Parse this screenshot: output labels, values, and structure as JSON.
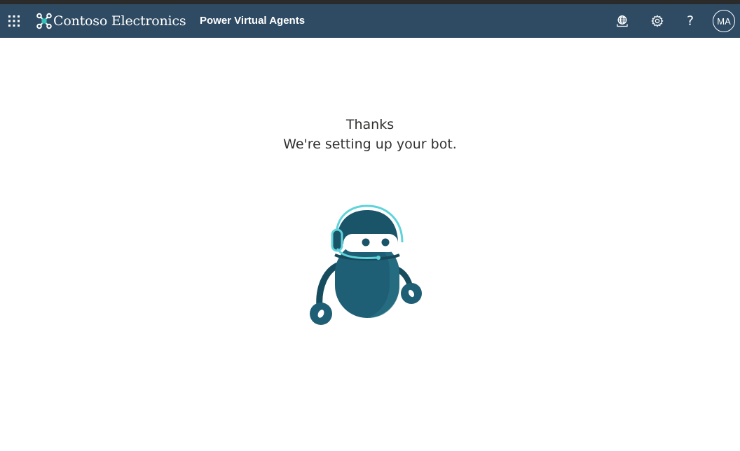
{
  "header": {
    "brand_name": "Contoso Electronics",
    "app_name": "Power Virtual Agents",
    "user_initials": "MA",
    "help_glyph": "?",
    "icons": [
      "waffle-icon",
      "contoso-logo-icon",
      "environment-icon",
      "gear-icon",
      "help-icon"
    ],
    "background_color": "#2f4b63"
  },
  "main": {
    "thanks_text": "Thanks",
    "status_text": "We're setting up your bot.",
    "illustration": "bot-with-headset-illustration"
  },
  "colors": {
    "bot_body": "#1f5f75",
    "bot_accent": "#5fd3d9",
    "text": "#323130"
  }
}
